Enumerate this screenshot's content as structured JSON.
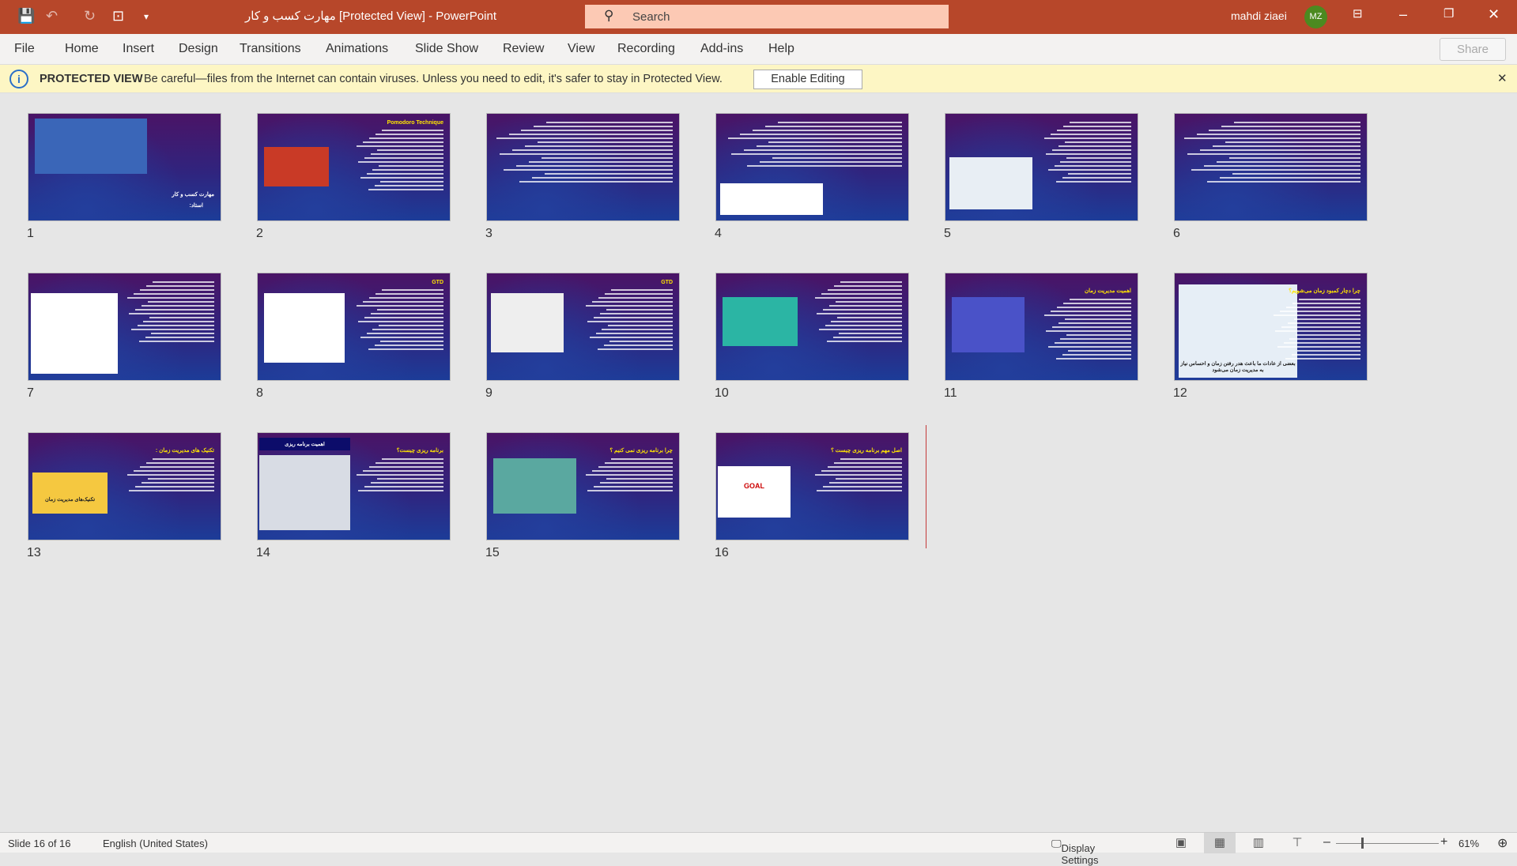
{
  "app": {
    "title": "مهارت کسب و کار [Protected View]  -  PowerPoint",
    "search_placeholder": "Search",
    "user_name": "mahdi ziaei",
    "user_initials": "MZ",
    "accent": "#b7472a"
  },
  "ribbon": {
    "tabs": [
      "File",
      "Home",
      "Insert",
      "Design",
      "Transitions",
      "Animations",
      "Slide Show",
      "Review",
      "View",
      "Recording",
      "Add-ins",
      "Help"
    ],
    "share": "Share"
  },
  "protected": {
    "label": "PROTECTED VIEW",
    "message": "Be careful—files from the Internet can contain viruses. Unless you need to edit, it's safer to stay in Protected View.",
    "button": "Enable Editing"
  },
  "slides": [
    {
      "n": "1",
      "title": "مهارت کسب و کار",
      "sub": "استاد:"
    },
    {
      "n": "2",
      "title": "Pomodoro Technique"
    },
    {
      "n": "3",
      "title": ""
    },
    {
      "n": "4",
      "title": ""
    },
    {
      "n": "5",
      "title": ""
    },
    {
      "n": "6",
      "title": ""
    },
    {
      "n": "7",
      "title": ""
    },
    {
      "n": "8",
      "title": "GTD"
    },
    {
      "n": "9",
      "title": "GTD"
    },
    {
      "n": "10",
      "title": ""
    },
    {
      "n": "11",
      "title": "اهمیت مدیریت زمان"
    },
    {
      "n": "12",
      "title": "چرا دچار کمبود زمان می‌شویم؟",
      "caption": "بعضی از عادات ما باعث هدر رفتن زمان و احساس نیاز به مدیریت زمان می‌شود"
    },
    {
      "n": "13",
      "title": "تکنیک های مدیریت زمان :",
      "caption": "تکنیک‌های مدیریت زمان"
    },
    {
      "n": "14",
      "title": "برنامه ریزی چیست؟",
      "caption": "اهمیت برنامه ریزی"
    },
    {
      "n": "15",
      "title": "چرا برنامه ریزی نمی کنیم ؟"
    },
    {
      "n": "16",
      "title": "اصل مهم برنامه ریزی چیست ؟",
      "caption": "GOAL"
    }
  ],
  "status": {
    "slide": "Slide 16 of 16",
    "language": "English (United States)",
    "display": "Display Settings",
    "zoom": "61%"
  }
}
